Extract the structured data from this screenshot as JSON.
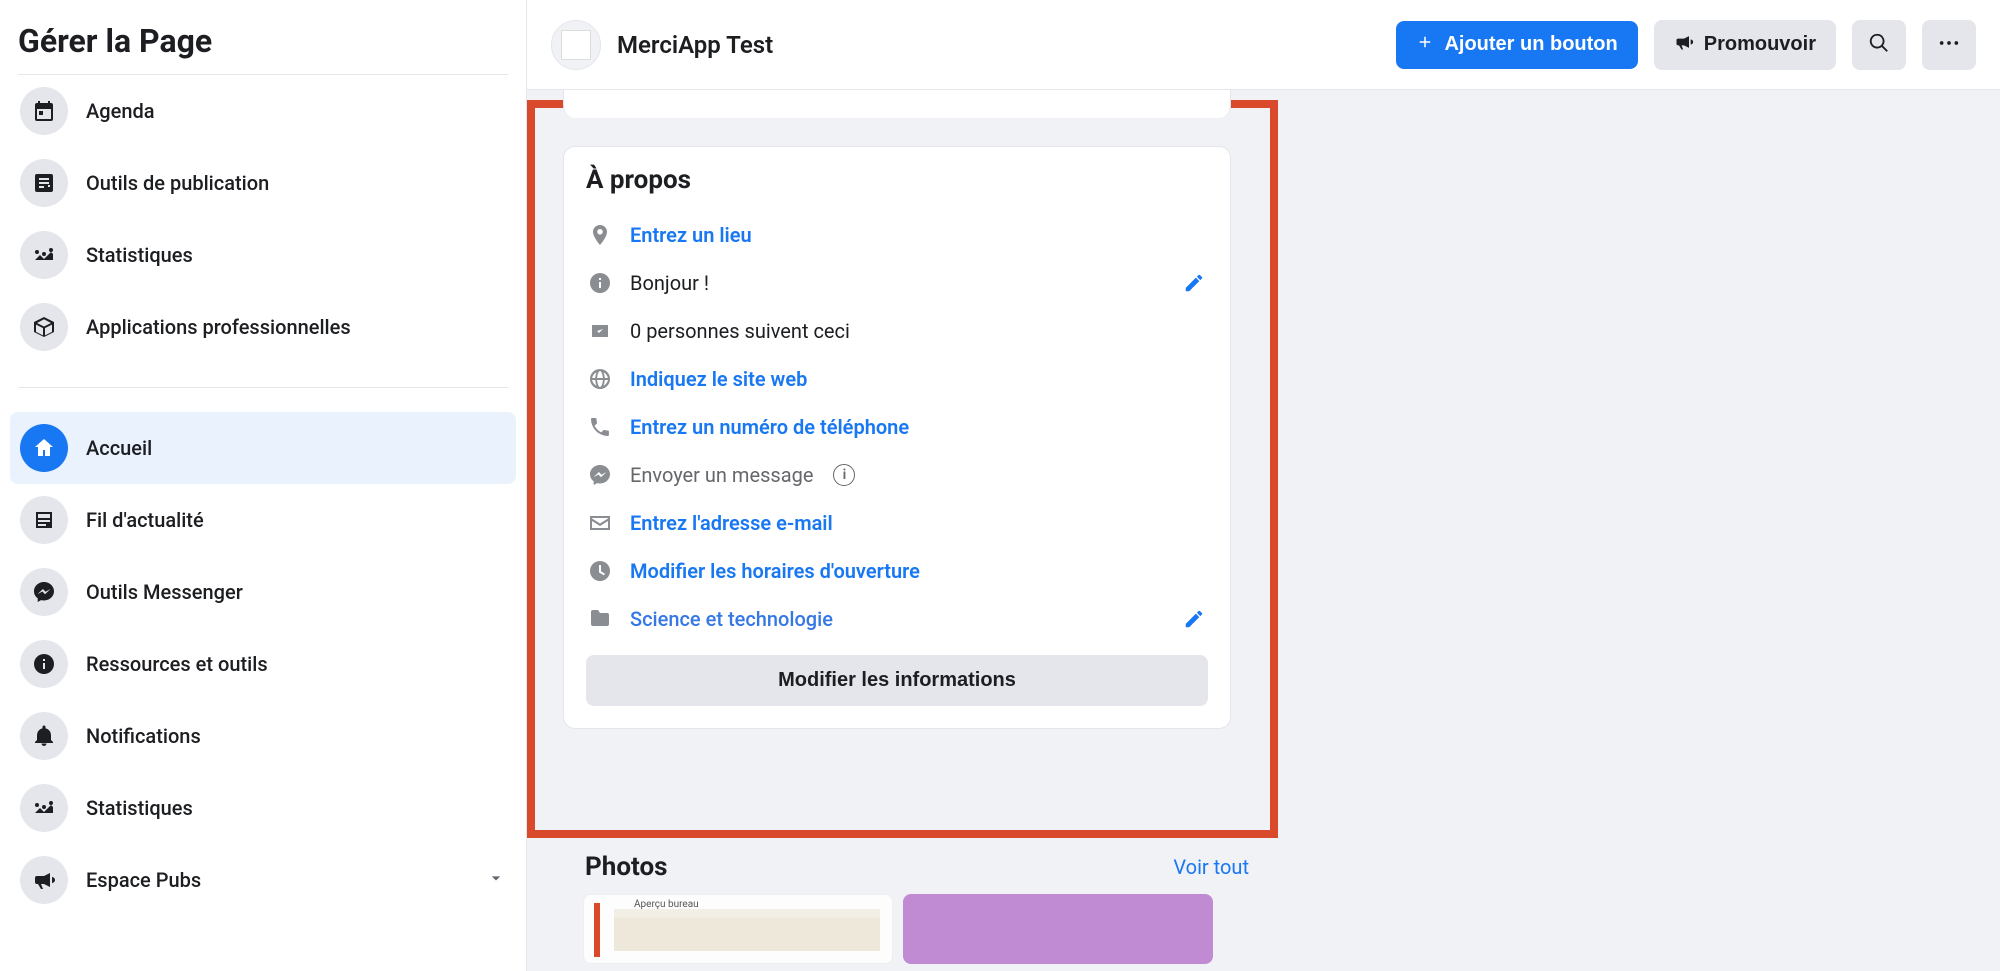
{
  "sidebar": {
    "title": "Gérer la Page",
    "group1": [
      {
        "label": "Agenda"
      },
      {
        "label": "Outils de publication"
      },
      {
        "label": "Statistiques"
      },
      {
        "label": "Applications professionnelles"
      }
    ],
    "group2": [
      {
        "label": "Accueil",
        "selected": true
      },
      {
        "label": "Fil d'actualité"
      },
      {
        "label": "Outils Messenger"
      },
      {
        "label": "Ressources et outils"
      },
      {
        "label": "Notifications"
      },
      {
        "label": "Statistiques"
      },
      {
        "label": "Espace Pubs",
        "chevron": true
      }
    ]
  },
  "header": {
    "page_name": "MerciApp Test",
    "add_button_label": "Ajouter un bouton",
    "promote_label": "Promouvoir"
  },
  "about": {
    "title": "À propos",
    "location": "Entrez un lieu",
    "greeting": "Bonjour !",
    "followers": "0 personnes suivent ceci",
    "website": "Indiquez le site web",
    "phone": "Entrez un numéro de téléphone",
    "message": "Envoyer un message",
    "email": "Entrez l'adresse e-mail",
    "hours": "Modifier les horaires d'ouverture",
    "category": "Science et technologie",
    "edit_button": "Modifier les informations"
  },
  "photos": {
    "title": "Photos",
    "see_all": "Voir tout",
    "thumb_label": "Aperçu bureau"
  }
}
